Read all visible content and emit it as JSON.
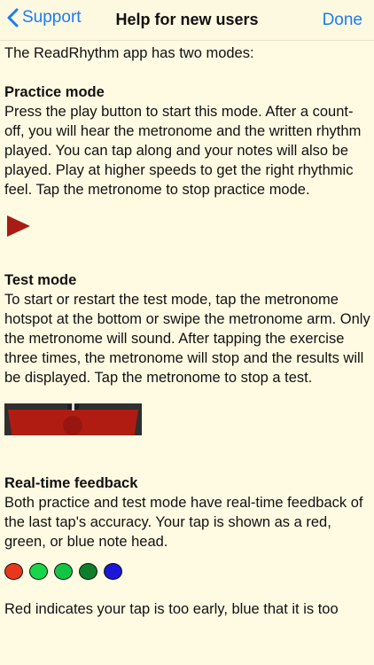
{
  "nav": {
    "back_label": "Support",
    "title": "Help for new users",
    "done_label": "Done"
  },
  "intro": "The ReadRhythm app has two modes:",
  "practice": {
    "heading": "Practice mode",
    "text": "Press the play button to start this mode. After a count-off, you will hear the metronome and the written rhythm played. You can tap along and your notes will also be played. Play at higher speeds to get the right rhythmic feel. Tap the metronome to stop practice mode.",
    "play_icon_color": "#a81c15"
  },
  "test": {
    "heading": "Test mode",
    "text": "To start or restart the test mode, tap the metronome hotspot at the bottom or swipe the metronome arm. Only the metronome will sound. After tapping the exercise three times, the metronome will stop and the results will be displayed. Tap the metronome to stop a test."
  },
  "feedback": {
    "heading": "Real-time feedback",
    "text": "Both practice and test mode have real-time feedback of the last tap's accuracy. Your tap is shown as a red, green, or blue note head.",
    "note_colors": [
      "#e8371f",
      "#18d64a",
      "#14c444",
      "#0d7f2b",
      "#1a17d8"
    ],
    "footer_text": "Red indicates your tap is too early, blue that it is too"
  },
  "colors": {
    "background": "#fffbe3",
    "accent": "#1a7cf6"
  }
}
